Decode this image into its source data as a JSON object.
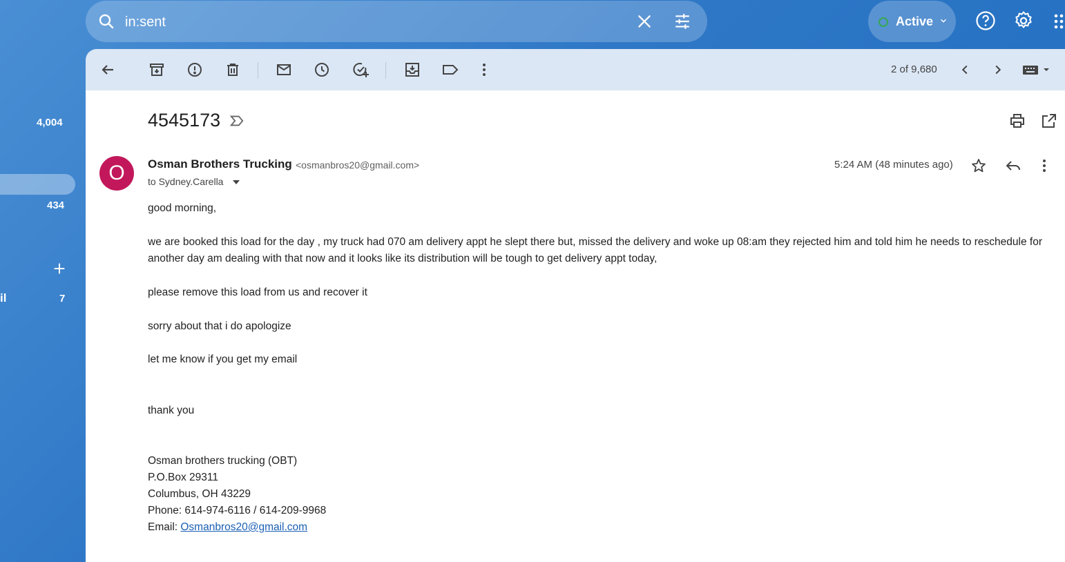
{
  "search": {
    "value": "in:sent"
  },
  "status": {
    "label": "Active"
  },
  "nav": {
    "inbox_count": "4,004",
    "count_434": "434",
    "label_fragment": "il",
    "label_count": "7"
  },
  "toolbar": {
    "paging": "2 of 9,680"
  },
  "message": {
    "subject": "4545173",
    "avatar_letter": "O",
    "sender_name": "Osman Brothers Trucking",
    "sender_email": "<osmanbros20@gmail.com>",
    "to": "to Sydney.Carella",
    "time": "5:24 AM (48 minutes ago)",
    "body": {
      "p1": "good morning,",
      "p2": "we are booked this load for the day , my truck had 070 am delivery appt he slept there but, missed the delivery  and woke up  08:am they rejected him and told him he needs to reschedule for another day am dealing with that now and it looks like its distribution will be tough to get delivery appt today,",
      "p3": "please  remove this load from us and recover it",
      "p4": "sorry about that i do apologize",
      "p5": "let me know if you get my email",
      "p6": "thank you",
      "sig1": "Osman brothers trucking (OBT)",
      "sig2": "P.O.Box 29311",
      "sig3": "Columbus, OH 43229",
      "sig4": "Phone: 614-974-6116 / 614-209-9968",
      "sig5_label": "Email: ",
      "sig5_link": "Osmanbros20@gmail.com"
    }
  },
  "colors": {
    "avatar": "#c2185b",
    "background": "#2f78c7",
    "toolbar": "#dbe7f5",
    "status_dot": "#1e8e3e"
  }
}
